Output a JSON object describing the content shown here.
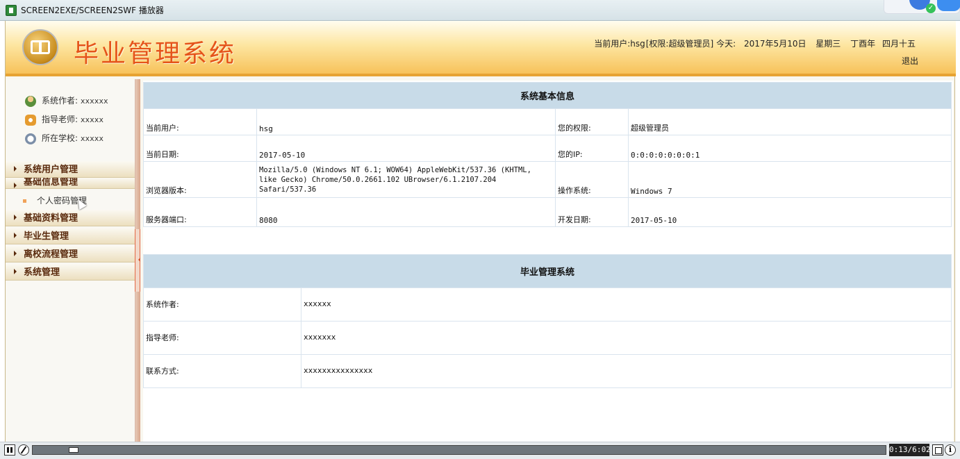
{
  "window": {
    "title": "SCREEN2EXE/SCREEN2SWF 播放器"
  },
  "header": {
    "app_title": "毕业管理系统",
    "user_info": {
      "current_user": "当前用户:hsg",
      "permission": "[权限:超级管理员]",
      "today_label": "今天:",
      "date": "2017年5月10日",
      "weekday": "星期三",
      "lunar_year": "丁酉年",
      "lunar_day": "四月十五"
    },
    "logout": "退出"
  },
  "sidebar": {
    "info": [
      {
        "label": "系统作者:",
        "value": "xxxxxx",
        "icon": "users-icon"
      },
      {
        "label": "指导老师:",
        "value": "xxxxx",
        "icon": "phone-icon"
      },
      {
        "label": "所在学校:",
        "value": "xxxxx",
        "icon": "clock-icon"
      }
    ],
    "menu": [
      {
        "label": "系统用户管理"
      },
      {
        "label": "基础信息管理"
      },
      {
        "label": "基础资料管理"
      },
      {
        "label": "毕业生管理"
      },
      {
        "label": "离校流程管理"
      },
      {
        "label": "系统管理"
      }
    ],
    "submenu": [
      {
        "label": "个人密码管理"
      }
    ]
  },
  "system_info": {
    "heading": "系统基本信息",
    "rows": [
      {
        "l1": "当前用户:",
        "v1": "hsg",
        "l2": "您的权限:",
        "v2": "超级管理员"
      },
      {
        "l1": "当前日期:",
        "v1": "2017-05-10",
        "l2": "您的IP:",
        "v2": "0:0:0:0:0:0:0:1"
      },
      {
        "l1": "浏览器版本:",
        "v1": "Mozilla/5.0 (Windows NT 6.1; WOW64) AppleWebKit/537.36 (KHTML, like Gecko) Chrome/50.0.2661.102 UBrowser/6.1.2107.204 Safari/537.36",
        "l2": "操作系统:",
        "v2": "Windows 7"
      },
      {
        "l1": "服务器端口:",
        "v1": "8080",
        "l2": "开发日期:",
        "v2": "2017-05-10"
      }
    ]
  },
  "about": {
    "heading": "毕业管理系统",
    "rows": [
      {
        "label": "系统作者:",
        "value": "xxxxxx"
      },
      {
        "label": "指导老师:",
        "value": "xxxxxxx"
      },
      {
        "label": "联系方式:",
        "value": "xxxxxxxxxxxxxxx"
      }
    ]
  },
  "player": {
    "time": "0:13/6:02",
    "progress": 0.036
  }
}
